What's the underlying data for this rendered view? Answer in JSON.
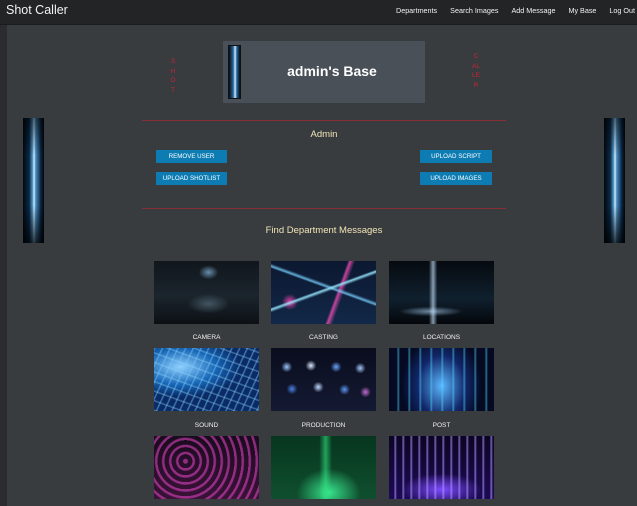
{
  "navbar": {
    "brand": "Shot Caller",
    "links": [
      "Departments",
      "Search Images",
      "Add Message",
      "My Base",
      "Log Out"
    ]
  },
  "header": {
    "title": "admin's Base",
    "left_vertical_text": "SHOT",
    "right_vertical_text": "CALLER"
  },
  "admin": {
    "section_title": "Admin",
    "buttons": {
      "remove_user": "REMOVE USER",
      "upload_shotlist": "UPLOAD SHOTLIST",
      "upload_script": "UPLOAD SCRIPT",
      "upload_images": "UPLOAD IMAGES"
    },
    "button_color": "#0d7cb3"
  },
  "departments": {
    "section_title": "Find Department Messages",
    "items": [
      {
        "label": "CAMERA"
      },
      {
        "label": "CASTING"
      },
      {
        "label": "LOCATIONS"
      },
      {
        "label": "SOUND"
      },
      {
        "label": "PRODUCTION"
      },
      {
        "label": "POST"
      }
    ]
  },
  "colors": {
    "accent_red": "#c9243a",
    "divider": "#8a2d39",
    "section_title": "#f1e4b8"
  }
}
